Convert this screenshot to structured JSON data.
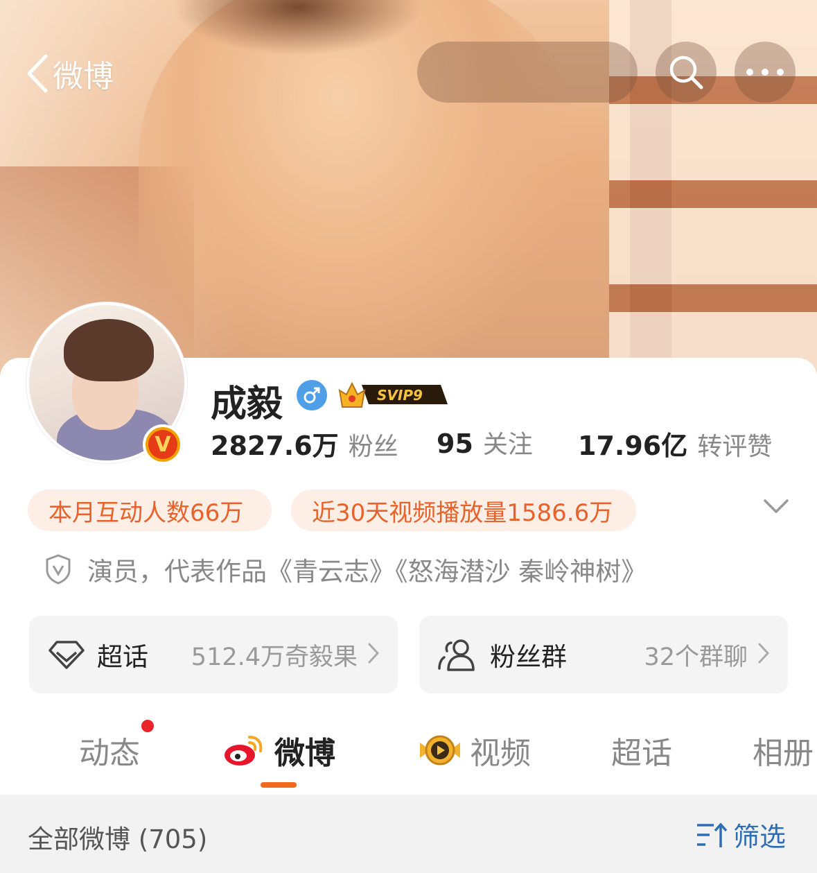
{
  "header": {
    "back_label": "微博"
  },
  "profile": {
    "name": "成毅",
    "verified_letter": "V",
    "svip_label": "SVIP9",
    "stats": [
      {
        "value": "2827.6万",
        "label": "粉丝"
      },
      {
        "value": "95",
        "label": "关注"
      },
      {
        "value": "17.96亿",
        "label": "转评赞"
      }
    ],
    "highlights": [
      "本月互动人数66万",
      "近30天视频播放量1586.6万"
    ],
    "description": "演员，代表作品《青云志》《怒海潜沙 秦岭神树》"
  },
  "boxes": [
    {
      "title": "超话",
      "value": "512.4万奇毅果"
    },
    {
      "title": "粉丝群",
      "value": "32个群聊"
    }
  ],
  "tabs": [
    {
      "label": "动态"
    },
    {
      "label": "微博"
    },
    {
      "label": "视频"
    },
    {
      "label": "超话"
    },
    {
      "label": "相册"
    }
  ],
  "feed": {
    "all_label": "全部微博 (705)",
    "filter_label": "筛选"
  },
  "colors": {
    "accent": "#f26b1d",
    "link": "#2f6eb5",
    "pill_bg": "#fdeee6"
  }
}
